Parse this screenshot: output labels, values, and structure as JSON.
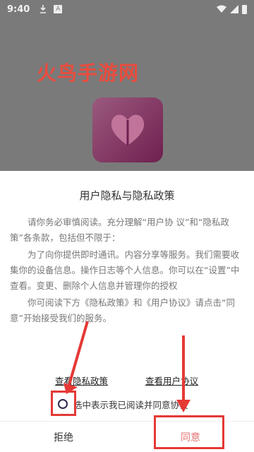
{
  "status_bar": {
    "time": "9:40",
    "icons_left": [
      "download-icon",
      "a-badge-icon"
    ],
    "icons_right": [
      "wifi-icon",
      "signal-icon",
      "battery-icon"
    ]
  },
  "watermark": {
    "text": "火鸟手游网",
    "color": "#e84c3d"
  },
  "dialog": {
    "title": "用户隐私与隐私政策",
    "paragraphs": [
      "请你务必审慎阅读。充分理解“用户协 议”和“隐私政策”各条款，包括但不限于：",
      "为了向你提供即时通讯。内容分享等服务。我们需要收集你的设备信息。操作日志等个人信息。你可以在“设置”中查看。变更、删除个人信息并管理你的授权",
      "你可阅读下方《隐私政策》和《用户协议》请点击“同意”开始接受我们的服务。"
    ],
    "links": {
      "privacy": "查看隐私政策",
      "user_agreement": "查看用户协议"
    },
    "agree_checkbox_label": "选中表示我已阅读并同意协议",
    "buttons": {
      "reject": "拒绝",
      "agree": "同意"
    }
  },
  "colors": {
    "overlay": "#7a7a7a",
    "agree_text": "#e57373",
    "annotation": "#e53935",
    "logo_gradient_start": "#9b5a7e",
    "logo_gradient_end": "#6f1f4f"
  }
}
